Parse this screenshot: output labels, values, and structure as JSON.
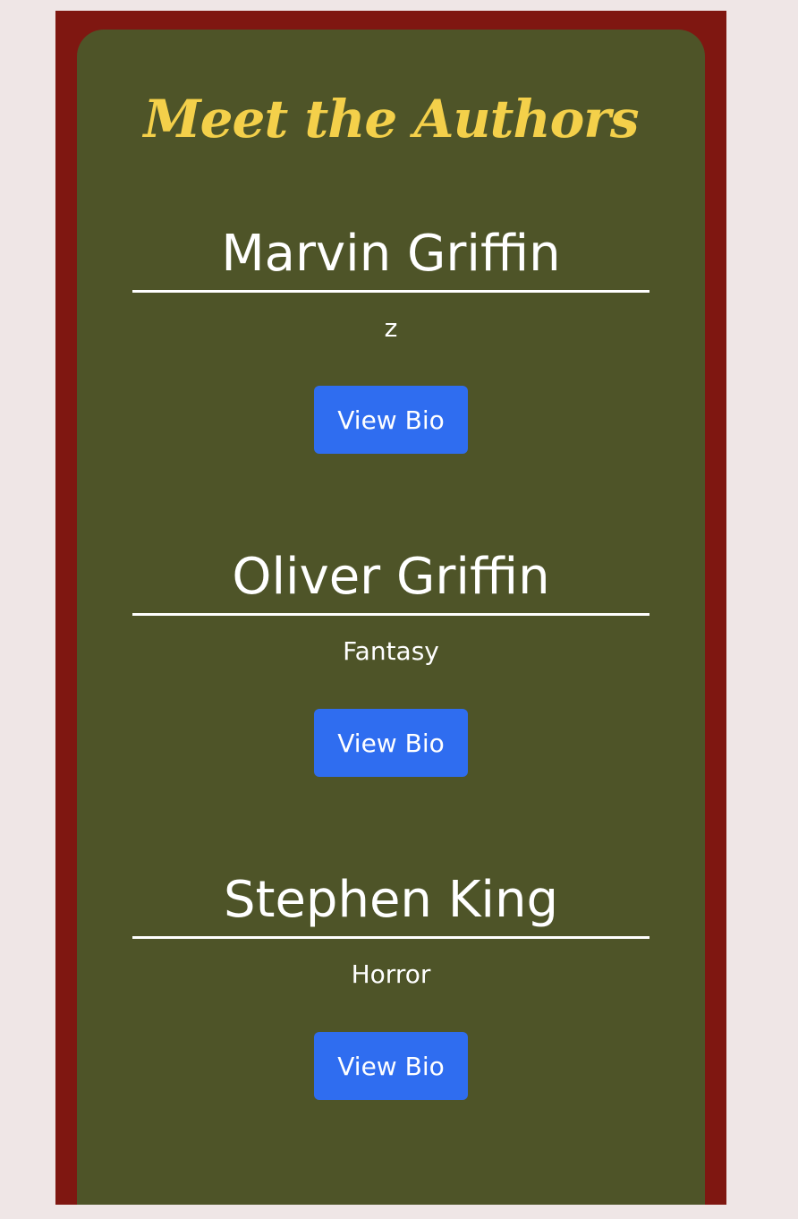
{
  "page": {
    "title": "Meet the Authors"
  },
  "authors": [
    {
      "name": "Marvin Griffin",
      "genre": "z",
      "button_label": "View Bio"
    },
    {
      "name": "Oliver Griffin",
      "genre": "Fantasy",
      "button_label": "View Bio"
    },
    {
      "name": "Stephen King",
      "genre": "Horror",
      "button_label": "View Bio"
    }
  ],
  "colors": {
    "page_background": "#efe6e6",
    "frame": "#7f1711",
    "panel": "#4e5428",
    "title": "#f4d04a",
    "button": "#2f6df0",
    "text": "#ffffff"
  }
}
